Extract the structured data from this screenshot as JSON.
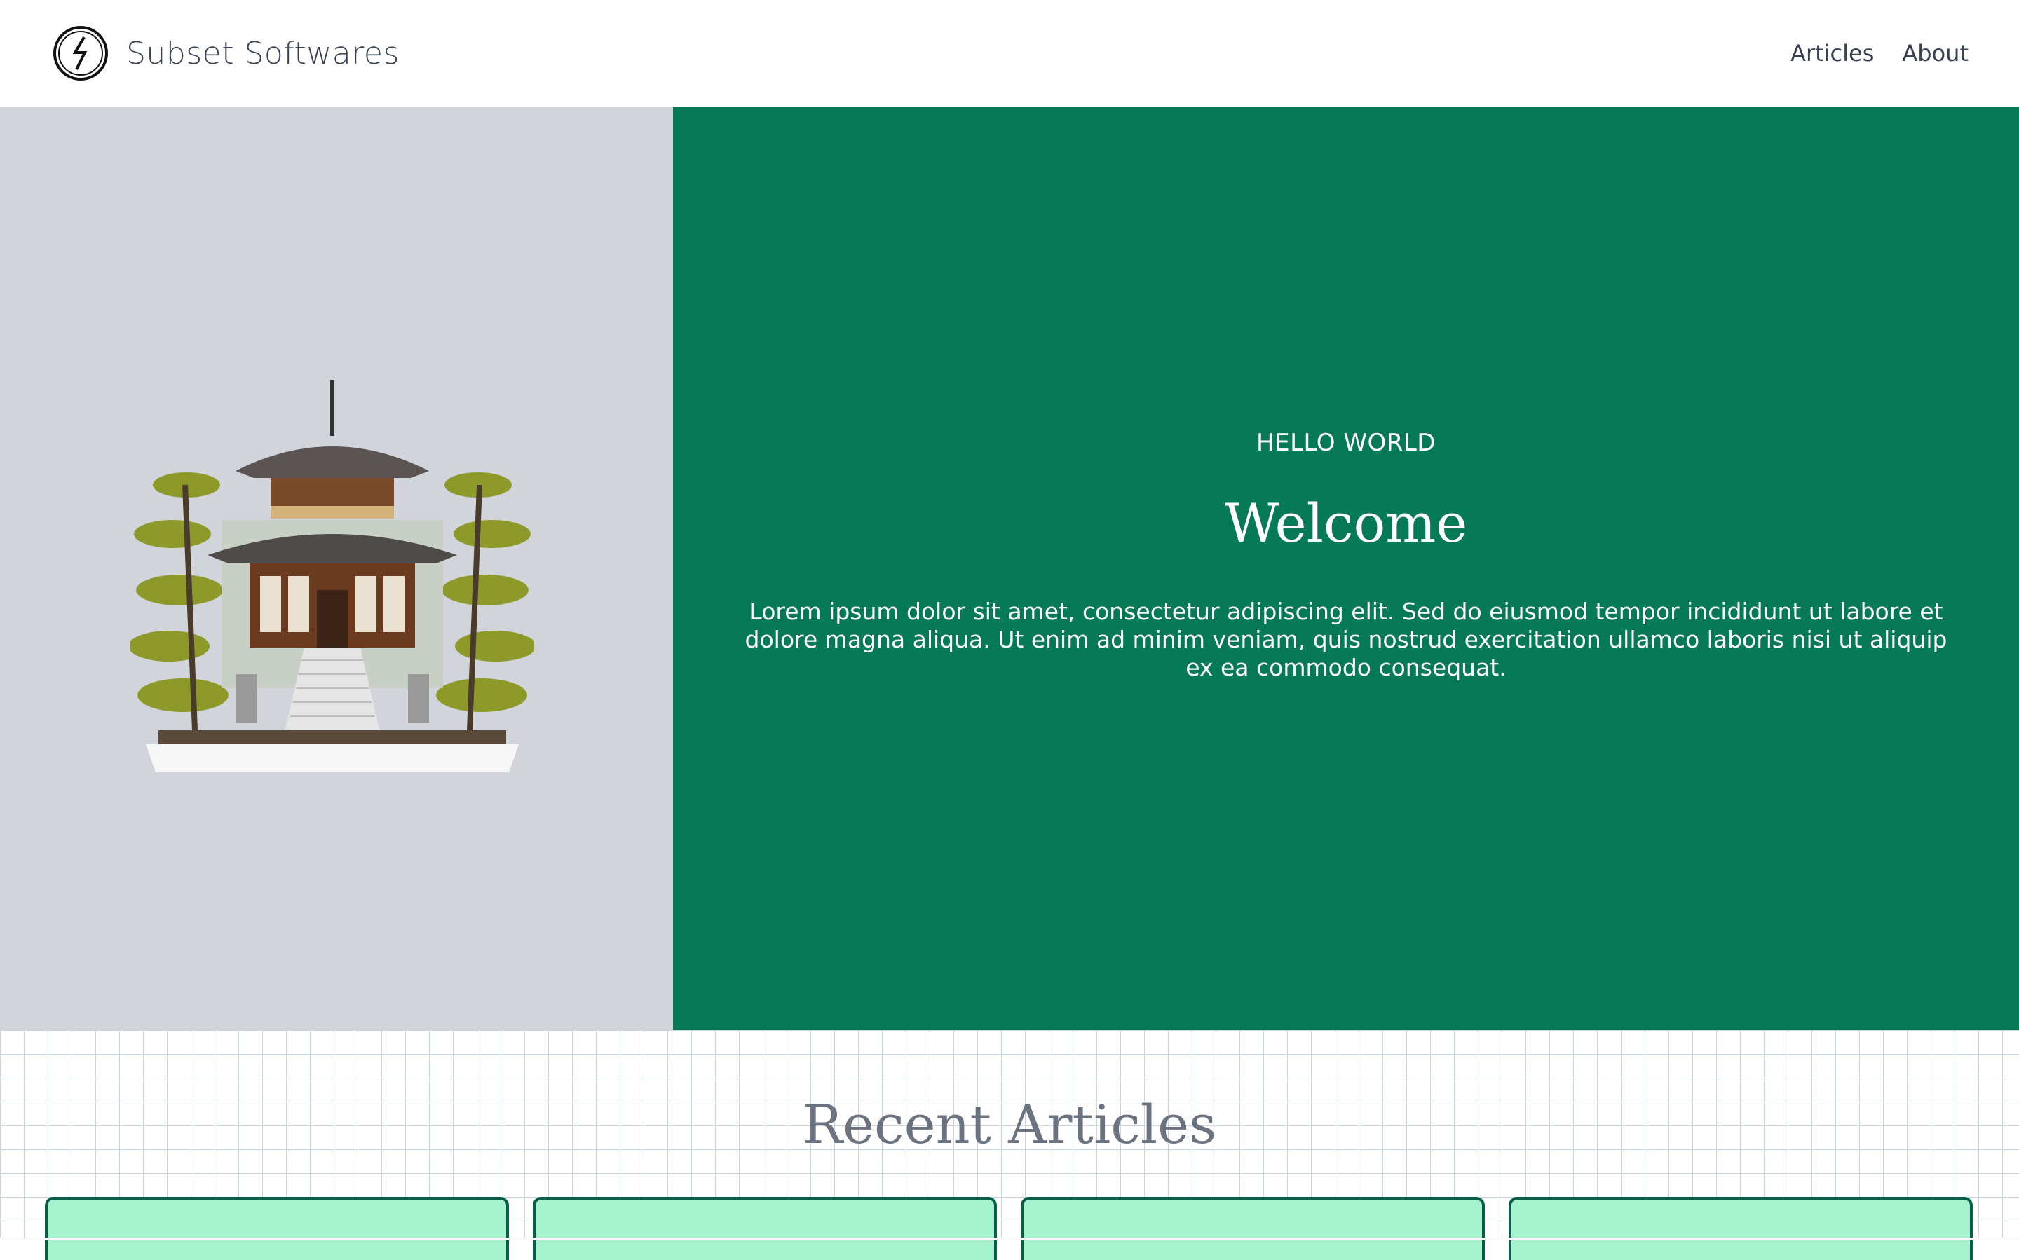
{
  "header": {
    "brand": "Subset Softwares",
    "logo_icon": "lightning-circle-icon",
    "nav": [
      {
        "label": "Articles"
      },
      {
        "label": "About"
      }
    ]
  },
  "hero": {
    "eyebrow": "HELLO WORLD",
    "title": "Welcome",
    "body": "Lorem ipsum dolor sit amet, consectetur adipiscing elit. Sed do eiusmod tempor incididunt ut labore et dolore magna aliqua. Ut enim ad minim veniam, quis nostrud exercitation ullamco laboris nisi ut aliquip ex ea commodo consequat.",
    "image_subject": "japanese-temple-illustration",
    "colors": {
      "panel": "#067a57",
      "image_bg": "#d1d5db"
    }
  },
  "articles": {
    "title": "Recent Articles",
    "card_count": 4,
    "colors": {
      "card": "#a7f3d0",
      "card_border": "#065f46"
    }
  }
}
